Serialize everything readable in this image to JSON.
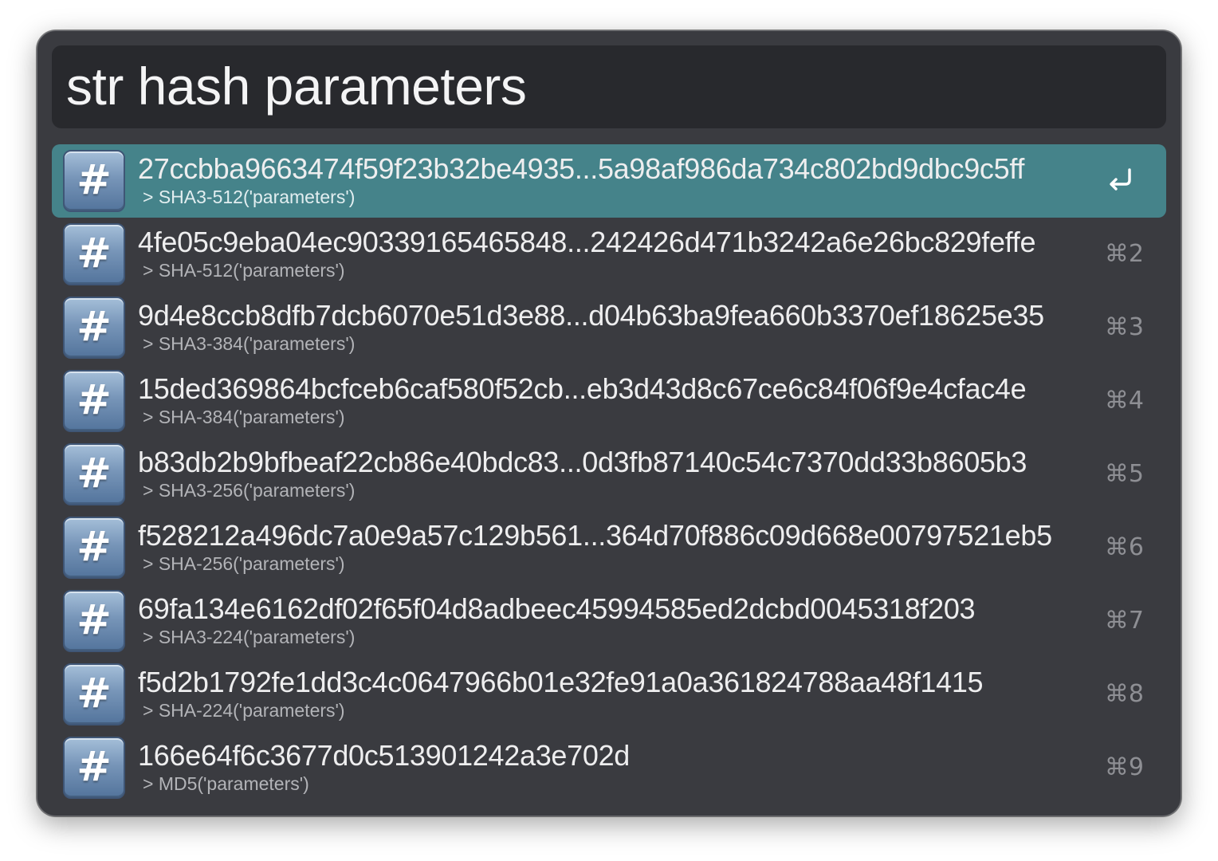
{
  "search": {
    "query": "str hash parameters"
  },
  "results": [
    {
      "title": "27ccbba9663474f59f23b32be4935...5a98af986da734c802bd9dbc9c5ff",
      "subtitle": "> SHA3-512('parameters')",
      "shortcut": "↩",
      "icon": "hash-icon",
      "selected": true
    },
    {
      "title": "4fe05c9eba04ec90339165465848...242426d471b3242a6e26bc829feffe",
      "subtitle": "> SHA-512('parameters')",
      "shortcut": "⌘2",
      "icon": "hash-icon"
    },
    {
      "title": "9d4e8ccb8dfb7dcb6070e51d3e88...d04b63ba9fea660b3370ef18625e35",
      "subtitle": "> SHA3-384('parameters')",
      "shortcut": "⌘3",
      "icon": "hash-icon"
    },
    {
      "title": "15ded369864bcfceb6caf580f52cb...eb3d43d8c67ce6c84f06f9e4cfac4e",
      "subtitle": "> SHA-384('parameters')",
      "shortcut": "⌘4",
      "icon": "hash-icon"
    },
    {
      "title": "b83db2b9bfbeaf22cb86e40bdc83...0d3fb87140c54c7370dd33b8605b3",
      "subtitle": "> SHA3-256('parameters')",
      "shortcut": "⌘5",
      "icon": "hash-icon"
    },
    {
      "title": "f528212a496dc7a0e9a57c129b561...364d70f886c09d668e00797521eb5",
      "subtitle": "> SHA-256('parameters')",
      "shortcut": "⌘6",
      "icon": "hash-icon"
    },
    {
      "title": "69fa134e6162df02f65f04d8adbeec45994585ed2dcbd0045318f203",
      "subtitle": "> SHA3-224('parameters')",
      "shortcut": "⌘7",
      "icon": "hash-icon"
    },
    {
      "title": "f5d2b1792fe1dd3c4c0647966b01e32fe91a0a361824788aa48f1415",
      "subtitle": "> SHA-224('parameters')",
      "shortcut": "⌘8",
      "icon": "hash-icon"
    },
    {
      "title": "166e64f6c3677d0c513901242a3e702d",
      "subtitle": "> MD5('parameters')",
      "shortcut": "⌘9",
      "icon": "hash-icon"
    }
  ],
  "icon_glyph": "#",
  "colors": {
    "window_bg": "#3a3b40",
    "search_bg": "#28292d",
    "selected_bg": "#45838a",
    "text": "#eeeeef",
    "subtext": "#b3b4b8",
    "shortcut": "#8e8f94"
  }
}
